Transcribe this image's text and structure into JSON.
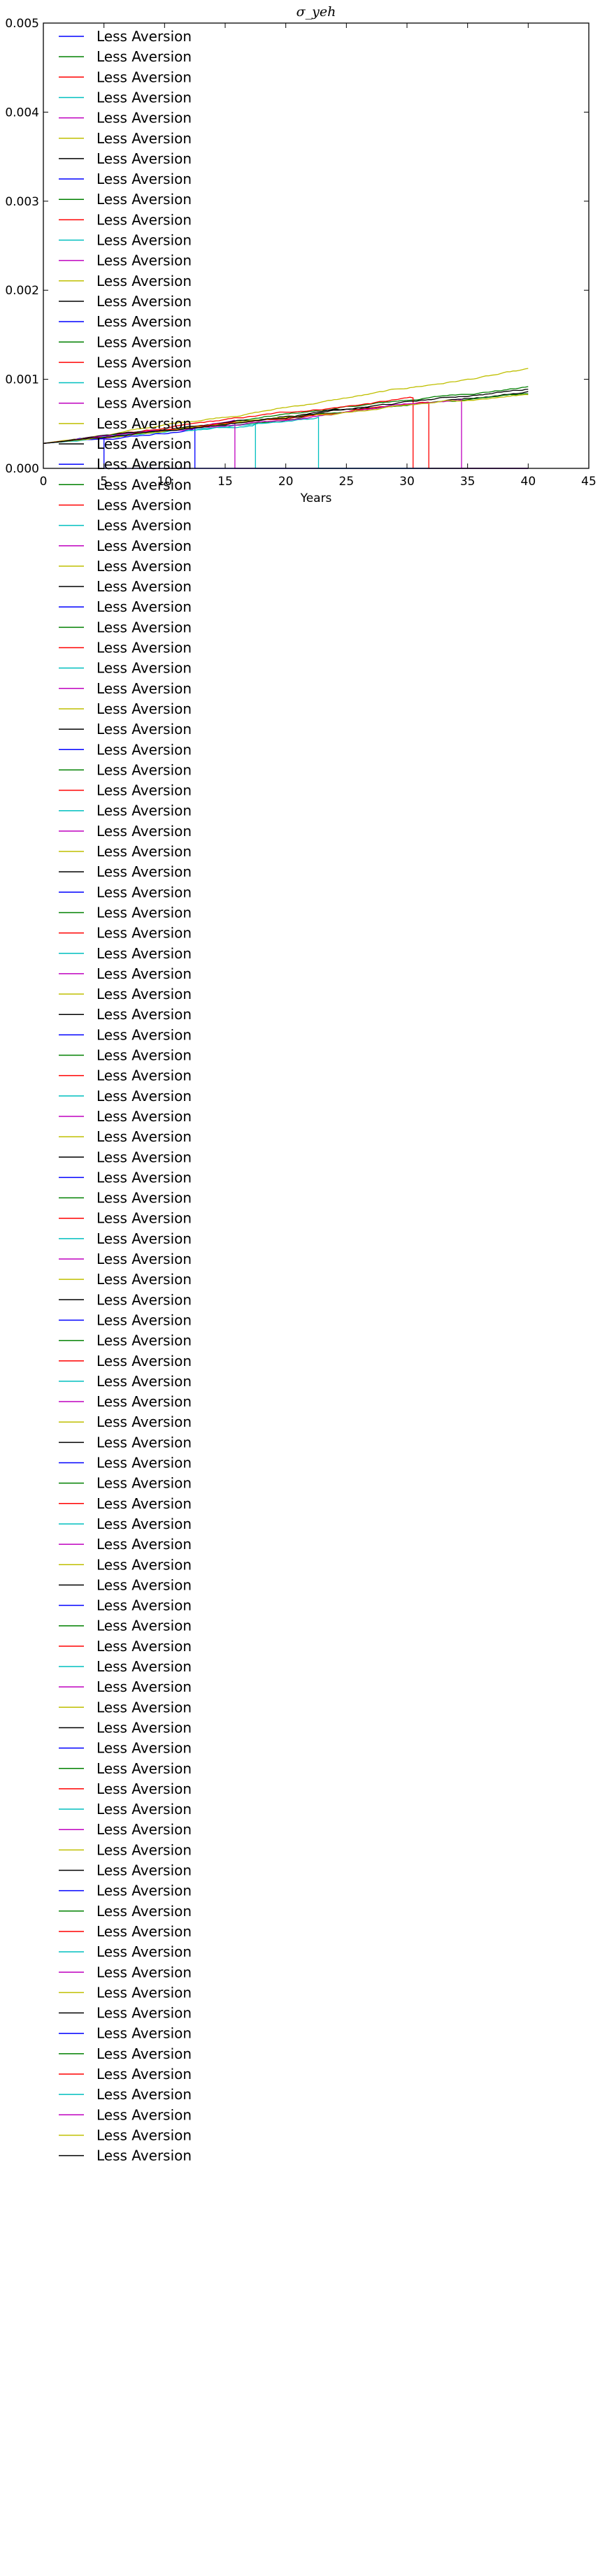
{
  "chart_data": {
    "type": "line",
    "title": "σ_yeh",
    "xlabel": "Years",
    "ylabel": "",
    "xlim": [
      0,
      45
    ],
    "ylim": [
      0,
      0.005
    ],
    "xticks": [
      "0",
      "5",
      "10",
      "15",
      "20",
      "25",
      "30",
      "35",
      "40",
      "45"
    ],
    "yticks": [
      "0.000",
      "0.001",
      "0.002",
      "0.003",
      "0.004",
      "0.005"
    ],
    "grid": false,
    "legend_position": "upper-left",
    "legend_entries": 105,
    "legend_label": "Less Aversion",
    "color_cycle": [
      "#0000ff",
      "#008000",
      "#ff0000",
      "#00bfbf",
      "#bf00bf",
      "#bfbf00",
      "#000000"
    ],
    "series_defaults": {
      "start": 0.00028,
      "end": 0.00085
    },
    "series": [
      {
        "name": "Less Aversion",
        "x": [
          0,
          40
        ],
        "y": [
          0.00028,
          0.00088
        ],
        "drop_to_zero_at": 5
      },
      {
        "name": "Less Aversion",
        "x": [
          0,
          40
        ],
        "y": [
          0.00028,
          0.00092
        ]
      },
      {
        "name": "Less Aversion",
        "x": [
          0,
          40
        ],
        "y": [
          0.00028,
          0.00095
        ],
        "drop_to_zero_at": 30.5
      },
      {
        "name": "Less Aversion",
        "x": [
          0,
          40
        ],
        "y": [
          0.00028,
          0.00078
        ],
        "drop_to_zero_at": 17.5
      },
      {
        "name": "Less Aversion",
        "x": [
          0,
          40
        ],
        "y": [
          0.00028,
          0.0009
        ],
        "drop_to_zero_at": 15.8
      },
      {
        "name": "Less Aversion",
        "x": [
          0,
          40
        ],
        "y": [
          0.00028,
          0.0011
        ]
      },
      {
        "name": "Less Aversion",
        "x": [
          0,
          40
        ],
        "y": [
          0.00028,
          0.00087
        ]
      },
      {
        "name": "Less Aversion",
        "x": [
          0,
          40
        ],
        "y": [
          0.00028,
          0.00082
        ],
        "drop_to_zero_at": 12.5
      },
      {
        "name": "Less Aversion",
        "x": [
          0,
          40
        ],
        "y": [
          0.00028,
          0.00084
        ]
      },
      {
        "name": "Less Aversion",
        "x": [
          0,
          40
        ],
        "y": [
          0.00028,
          0.00086
        ],
        "drop_to_zero_at": 31.8
      },
      {
        "name": "Less Aversion",
        "x": [
          0,
          40
        ],
        "y": [
          0.00028,
          0.0008
        ],
        "drop_to_zero_at": 22.7
      },
      {
        "name": "Less Aversion",
        "x": [
          0,
          40
        ],
        "y": [
          0.00028,
          0.00085
        ],
        "drop_to_zero_at": 34.5
      },
      {
        "name": "Less Aversion",
        "x": [
          0,
          40
        ],
        "y": [
          0.00028,
          0.00083
        ]
      },
      {
        "name": "Less Aversion",
        "x": [
          0,
          40
        ],
        "y": [
          0.00028,
          0.00089
        ]
      }
    ]
  }
}
